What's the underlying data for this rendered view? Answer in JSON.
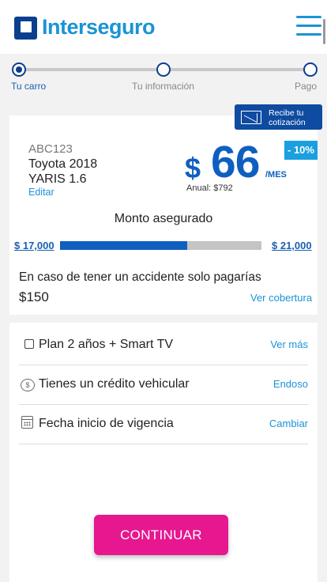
{
  "header": {
    "logo_text": "Interseguro",
    "menu_icon": "hamburger-menu-icon"
  },
  "stepper": {
    "steps": [
      {
        "label": "Tu carro",
        "active": true
      },
      {
        "label": "Tu información",
        "active": false
      },
      {
        "label": "Pago",
        "active": false
      }
    ]
  },
  "quote_button": {
    "label_line1": "Recibe tu",
    "label_line2": "cotización",
    "icon": "envelope-icon"
  },
  "vehicle": {
    "plate": "ABC123",
    "model_line1": "Toyota 2018",
    "model_line2": "YARIS 1.6",
    "edit_label": "Editar"
  },
  "price": {
    "currency": "$",
    "amount": "66",
    "period": "/MES",
    "annual": "Anual: $792",
    "discount": "- 10%"
  },
  "insured_amount": {
    "title": "Monto asegurado",
    "min": "$ 17,000",
    "max": "$ 21,000",
    "fill_fraction": 0.63
  },
  "deductible": {
    "text": "En caso de tener un accidente solo pagarías",
    "amount": "$150",
    "link": "Ver cobertura"
  },
  "options": [
    {
      "label": "Plan 2 años + Smart TV",
      "link": "Ver más",
      "icon": "checkbox"
    },
    {
      "label": "Tienes un crédito vehicular",
      "link": "Endoso",
      "icon": "piggy-bank-icon"
    },
    {
      "label": "Fecha inicio de vigencia",
      "link": "Cambiar",
      "icon": "calendar-icon"
    }
  ],
  "cta": {
    "label": "CONTINUAR"
  },
  "colors": {
    "primary": "#0f5fc0",
    "accent": "#1a93d6",
    "cta": "#e6178f"
  }
}
